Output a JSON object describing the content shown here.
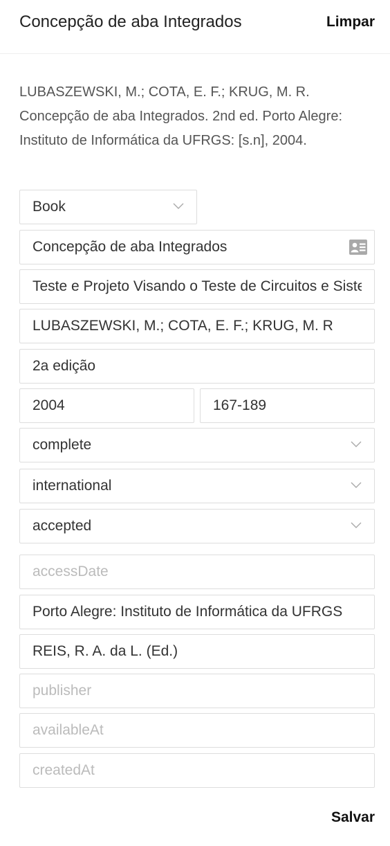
{
  "header": {
    "title": "Concepção de aba Integrados",
    "clear_label": "Limpar"
  },
  "citation": "LUBASZEWSKI, M.; COTA, E. F.; KRUG, M. R. Concepção de aba Integrados. 2nd ed. Porto Alegre: Instituto de Informática da UFRGS: [s.n], 2004.",
  "form": {
    "type": {
      "value": "Book"
    },
    "title": {
      "value": "Concepção de aba Integrados",
      "icon": "contact-card-icon"
    },
    "subtitle": {
      "value": "Teste e Projeto Visando o Teste de Circuitos e Sistemas Integrados"
    },
    "authors": {
      "value": "LUBASZEWSKI, M.; COTA, E. F.; KRUG, M. R"
    },
    "edition": {
      "value": "2a edição"
    },
    "year": {
      "value": "2004"
    },
    "pages": {
      "value": "167-189"
    },
    "completeness": {
      "value": "complete"
    },
    "scope": {
      "value": "international"
    },
    "status": {
      "value": "accepted"
    },
    "access_date": {
      "value": "",
      "placeholder": "accessDate"
    },
    "publication_place": {
      "value": "Porto Alegre: Instituto de Informática da UFRGS"
    },
    "editors": {
      "value": "REIS, R. A. da L. (Ed.)"
    },
    "publisher": {
      "value": "",
      "placeholder": "publisher"
    },
    "available_at": {
      "value": "",
      "placeholder": "availableAt"
    },
    "created_at": {
      "value": "",
      "placeholder": "createdAt"
    }
  },
  "footer": {
    "save_label": "Salvar"
  },
  "colors": {
    "border": "#dddddd",
    "text": "#333333",
    "placeholder": "#bbbbbb",
    "muted_text": "#555555",
    "icon": "#a9a9a9"
  }
}
